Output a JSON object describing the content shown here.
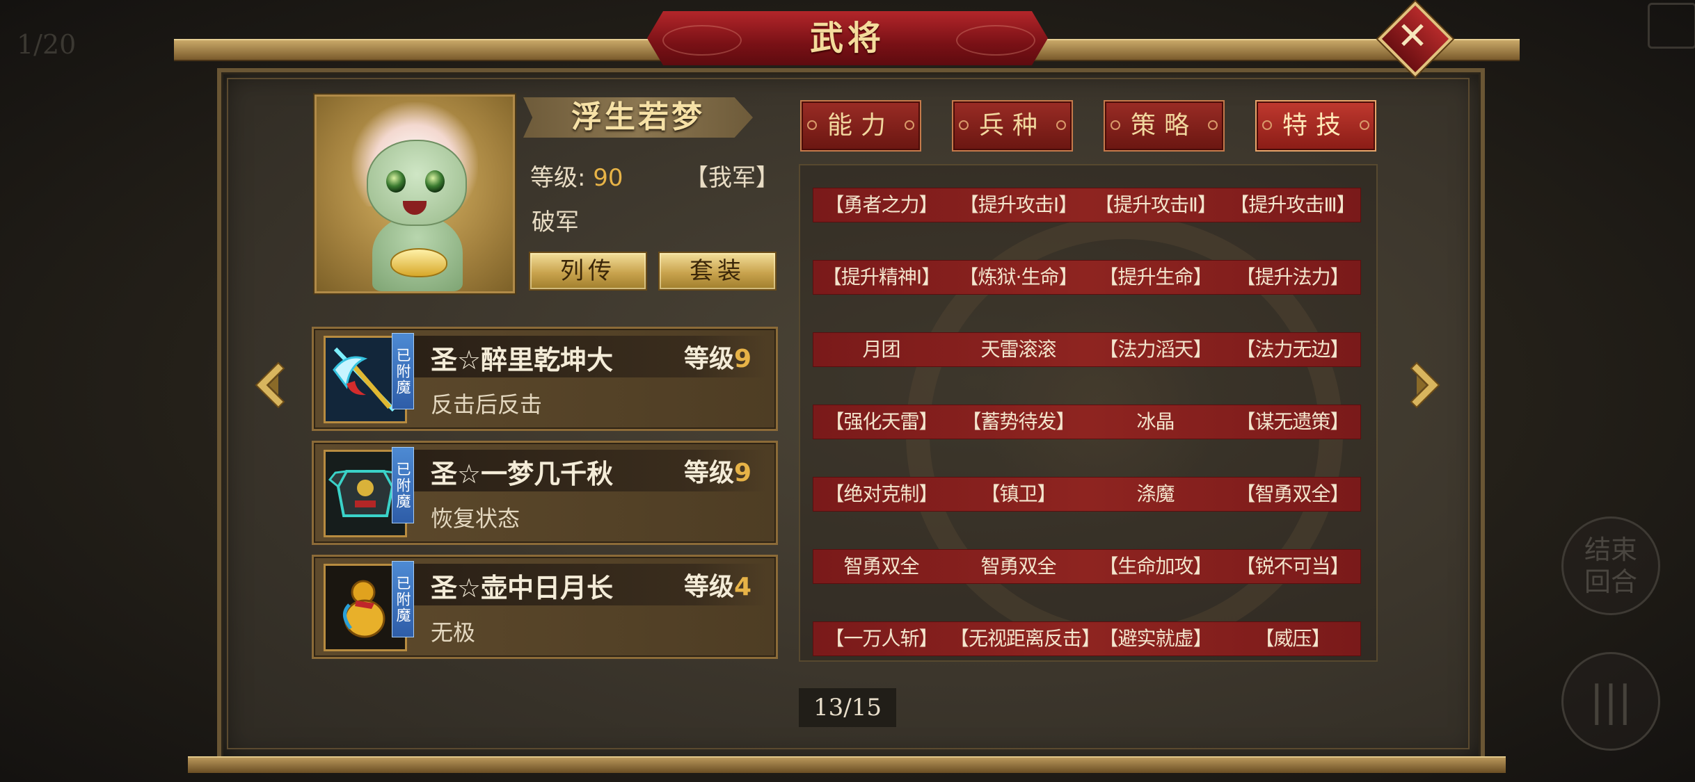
{
  "screen_counter": "1/20",
  "title": "武将",
  "general": {
    "name": "浮生若梦",
    "level_label": "等级:",
    "level_value": "90",
    "faction": "【我军】",
    "trait": "破军",
    "buttons": {
      "biography": "列传",
      "equipment_set": "套装"
    }
  },
  "equipment": [
    {
      "badge": "已附魔",
      "name": "圣☆醉里乾坤大",
      "level_label": "等级",
      "level_value": "9",
      "effect": "反击后反击",
      "icon": "glaive-icon"
    },
    {
      "badge": "已附魔",
      "name": "圣☆一梦几千秋",
      "level_label": "等级",
      "level_value": "9",
      "effect": "恢复状态",
      "icon": "armor-icon"
    },
    {
      "badge": "已附魔",
      "name": "圣☆壶中日月长",
      "level_label": "等级",
      "level_value": "4",
      "effect": "无极",
      "icon": "gourd-icon"
    }
  ],
  "tabs": [
    {
      "label": "能力",
      "active": false
    },
    {
      "label": "兵种",
      "active": false
    },
    {
      "label": "策略",
      "active": false
    },
    {
      "label": "特技",
      "active": true
    }
  ],
  "skills": [
    [
      "【勇者之力】",
      "【提升攻击Ⅰ】",
      "【提升攻击Ⅱ】",
      "【提升攻击Ⅲ】"
    ],
    [
      "【提升精神Ⅰ】",
      "【炼狱·生命】",
      "【提升生命】",
      "【提升法力】"
    ],
    [
      "月团",
      "天雷滚滚",
      "【法力滔天】",
      "【法力无边】"
    ],
    [
      "【强化天雷】",
      "【蓄势待发】",
      "冰晶",
      "【谋无遗策】"
    ],
    [
      "【绝对克制】",
      "【镇卫】",
      "涤魔",
      "【智勇双全】"
    ],
    [
      "智勇双全",
      "智勇双全",
      "【生命加攻】",
      "【锐不可当】"
    ],
    [
      "【一万人斩】",
      "【无视距离反击】",
      "【避实就虚】",
      "【威压】"
    ]
  ],
  "pagination": "13/15",
  "end_turn": "结束回合",
  "colors": {
    "accent_red": "#8e2420",
    "gold": "#e7b347",
    "frame_gold": "#c9a868"
  }
}
